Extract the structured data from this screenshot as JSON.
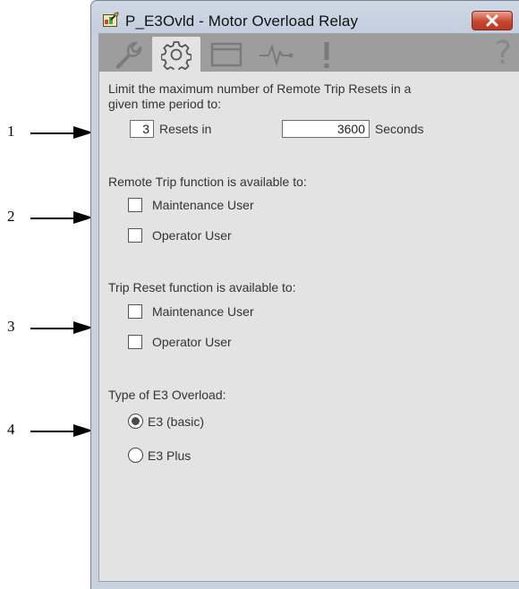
{
  "callouts": [
    "1",
    "2",
    "3",
    "4"
  ],
  "window": {
    "title": "P_E3Ovld - Motor Overload Relay",
    "tabs": [
      {
        "icon": "wrench-icon"
      },
      {
        "icon": "gear-icon",
        "active": true
      },
      {
        "icon": "window-icon"
      },
      {
        "icon": "trend-icon"
      },
      {
        "icon": "alarm-icon"
      }
    ],
    "help_glyph": "?"
  },
  "reset_limit": {
    "label_line1": "Limit the maximum number of Remote Trip Resets in a",
    "label_line2": "given time period to:",
    "count_value": "3",
    "resets_in_label": "Resets in",
    "seconds_value": "3600",
    "seconds_label": "Seconds"
  },
  "remote_trip": {
    "heading": "Remote Trip function is available to:",
    "options": [
      "Maintenance User",
      "Operator User"
    ]
  },
  "trip_reset": {
    "heading": "Trip Reset function is available to:",
    "options": [
      "Maintenance User",
      "Operator User"
    ]
  },
  "overload_type": {
    "heading": "Type of E3 Overload:",
    "options": [
      "E3 (basic)",
      "E3 Plus"
    ],
    "selected": "E3 (basic)"
  }
}
